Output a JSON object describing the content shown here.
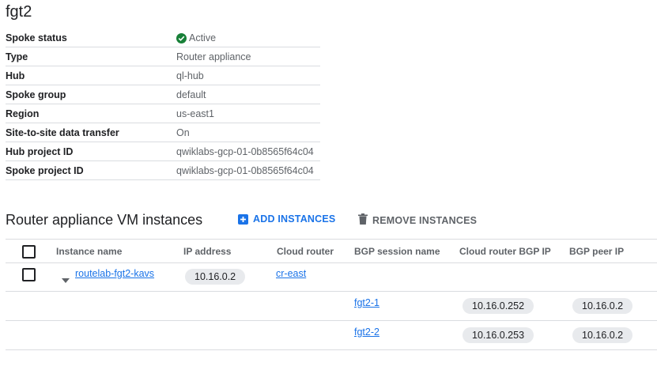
{
  "title": "fgt2",
  "details": [
    {
      "key": "Spoke status",
      "value": "Active"
    },
    {
      "key": "Type",
      "value": "Router appliance"
    },
    {
      "key": "Hub",
      "value": "ql-hub"
    },
    {
      "key": "Spoke group",
      "value": "default"
    },
    {
      "key": "Region",
      "value": "us-east1"
    },
    {
      "key": "Site-to-site data transfer",
      "value": "On"
    },
    {
      "key": "Hub project ID",
      "value": "qwiklabs-gcp-01-0b8565f64c04"
    },
    {
      "key": "Spoke project ID",
      "value": "qwiklabs-gcp-01-0b8565f64c04"
    }
  ],
  "section": {
    "title": "Router appliance VM instances",
    "add_label": "ADD INSTANCES",
    "remove_label": "REMOVE INSTANCES"
  },
  "table": {
    "headers": [
      "Instance name",
      "IP address",
      "Cloud router",
      "BGP session name",
      "Cloud router BGP IP",
      "BGP peer IP"
    ],
    "instance": {
      "name": "routelab-fgt2-kavs",
      "ip": "10.16.0.2",
      "router": "cr-east"
    },
    "sessions": [
      {
        "name": "fgt2-1",
        "router_ip": "10.16.0.252",
        "peer_ip": "10.16.0.2"
      },
      {
        "name": "fgt2-2",
        "router_ip": "10.16.0.253",
        "peer_ip": "10.16.0.2"
      }
    ]
  },
  "colors": {
    "accent": "#1a73e8",
    "success": "#188038"
  }
}
